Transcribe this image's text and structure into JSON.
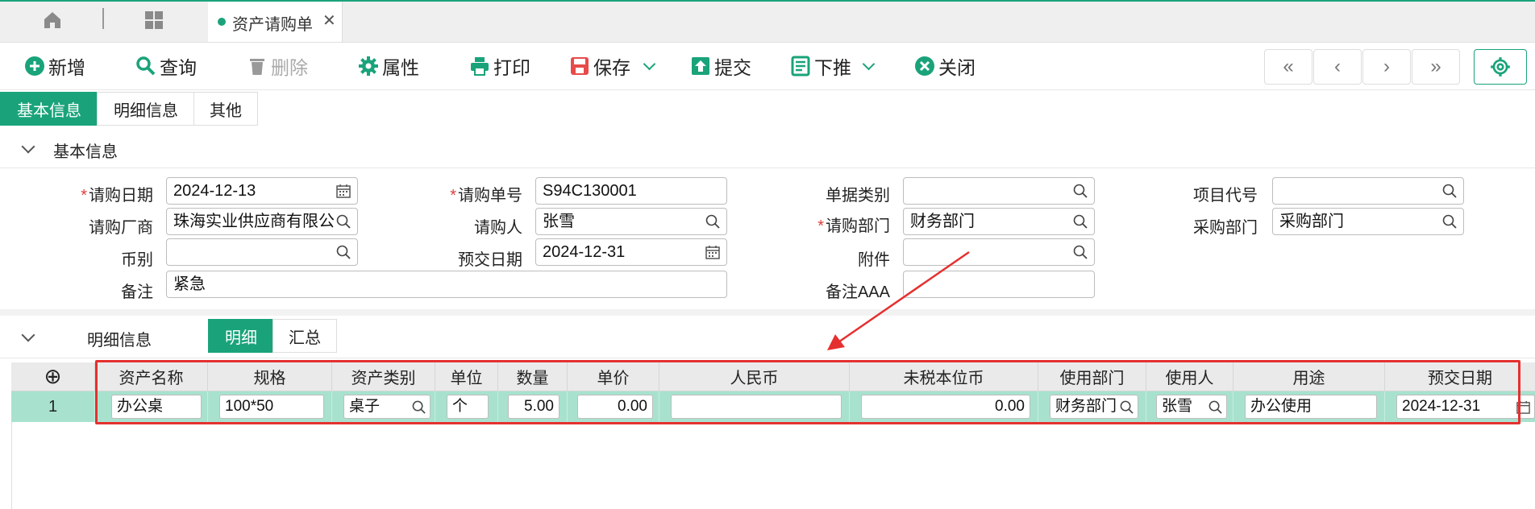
{
  "tabbar": {
    "doc_tab": "资产请购单",
    "close": "✕"
  },
  "toolbar": {
    "add": "新增",
    "query": "查询",
    "delete": "删除",
    "props": "属性",
    "print": "打印",
    "save": "保存",
    "submit": "提交",
    "push": "下推",
    "close": "关闭"
  },
  "nav": {
    "first": "«",
    "prev": "‹",
    "next": "›",
    "last": "»"
  },
  "section_tabs": [
    "基本信息",
    "明细信息",
    "其他"
  ],
  "basic": {
    "title": "基本信息",
    "request_date_label": "请购日期",
    "request_date": "2024-12-13",
    "request_no_label": "请购单号",
    "request_no": "S94C130001",
    "doc_type_label": "单据类别",
    "doc_type": "",
    "project_code_label": "项目代号",
    "project_code": "",
    "vendor_label": "请购厂商",
    "vendor": "珠海实业供应商有限公",
    "requester_label": "请购人",
    "requester": "张雪",
    "request_dept_label": "请购部门",
    "request_dept": "财务部门",
    "purchase_dept_label": "采购部门",
    "purchase_dept": "采购部门",
    "currency_label": "币别",
    "currency": "",
    "delivery_date_label": "预交日期",
    "delivery_date": "2024-12-31",
    "attachment_label": "附件",
    "attachment": "",
    "remark_label": "备注",
    "remark": "紧急",
    "remark_aaa_label": "备注AAA",
    "remark_aaa": ""
  },
  "detail": {
    "title": "明细信息",
    "toggle": [
      "明细",
      "汇总"
    ],
    "add_icon": "⊕",
    "columns": [
      "资产名称",
      "规格",
      "资产类别",
      "单位",
      "数量",
      "单价",
      "人民币",
      "未税本位币",
      "使用部门",
      "使用人",
      "用途",
      "预交日期"
    ],
    "rows": [
      {
        "no": "1",
        "name": "办公桌",
        "spec": "100*50",
        "category": "桌子",
        "unit": "个",
        "qty": "5.00",
        "price": "0.00",
        "rmb": "",
        "untaxed": "0.00",
        "dept": "财务部门",
        "user": "张雪",
        "purpose": "办公使用",
        "date": "2024-12-31"
      }
    ]
  },
  "colors": {
    "accent": "#1aa37a",
    "row_highlight": "#a8e2cf",
    "annotation": "#e53030"
  }
}
